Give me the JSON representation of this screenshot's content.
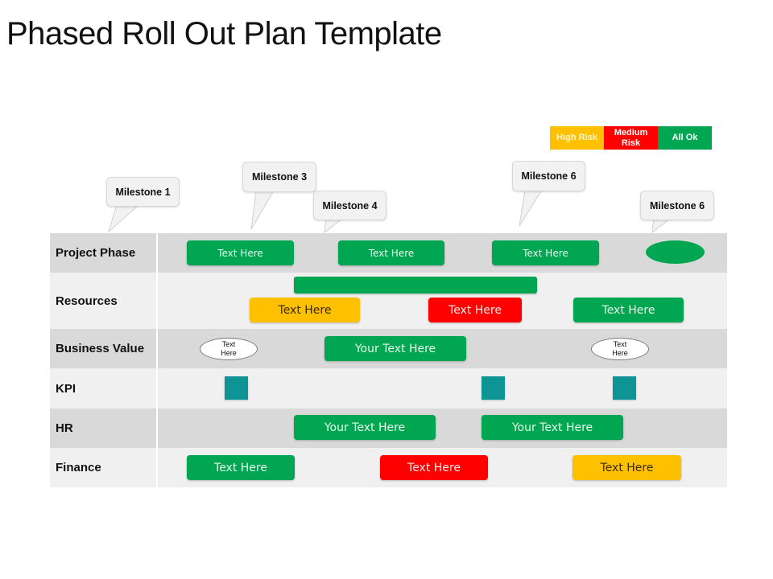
{
  "title": "Phased Roll Out Plan Template",
  "legend": [
    {
      "label": "High Risk",
      "color": "#ffc000"
    },
    {
      "label": "Medium Risk",
      "color": "#ff0000"
    },
    {
      "label": "All Ok",
      "color": "#00a651"
    }
  ],
  "milestones": [
    {
      "label": "Milestone 1"
    },
    {
      "label": "Milestone 3"
    },
    {
      "label": "Milestone 4"
    },
    {
      "label": "Milestone 6"
    },
    {
      "label": "Milestone 6"
    }
  ],
  "rows": [
    {
      "label": "Project Phase",
      "items": [
        {
          "text": "Text Here",
          "status": "All Ok"
        },
        {
          "text": "Text Here",
          "status": "All Ok"
        },
        {
          "text": "Text Here",
          "status": "All Ok"
        },
        {
          "text": "",
          "status": "All Ok",
          "shape": "oval"
        }
      ]
    },
    {
      "label": "Resources",
      "items": [
        {
          "text": "",
          "status": "All Ok"
        },
        {
          "text": "Text Here",
          "status": "High Risk"
        },
        {
          "text": "Text Here",
          "status": "Medium Risk"
        },
        {
          "text": "Text Here",
          "status": "All Ok"
        }
      ]
    },
    {
      "label": "Business Value",
      "items": [
        {
          "text": "Text Here",
          "shape": "oval"
        },
        {
          "text": "Your Text Here",
          "status": "All Ok"
        },
        {
          "text": "Text Here",
          "shape": "oval"
        }
      ]
    },
    {
      "label": "KPI",
      "items": [
        {
          "shape": "square"
        },
        {
          "shape": "square"
        },
        {
          "shape": "square"
        }
      ]
    },
    {
      "label": "HR",
      "items": [
        {
          "text": "Your Text Here",
          "status": "All Ok"
        },
        {
          "text": "Your Text Here",
          "status": "All Ok"
        }
      ]
    },
    {
      "label": "Finance",
      "items": [
        {
          "text": "Text Here",
          "status": "All Ok"
        },
        {
          "text": "Text Here",
          "status": "Medium Risk"
        },
        {
          "text": "Text Here",
          "status": "High Risk"
        }
      ]
    }
  ]
}
